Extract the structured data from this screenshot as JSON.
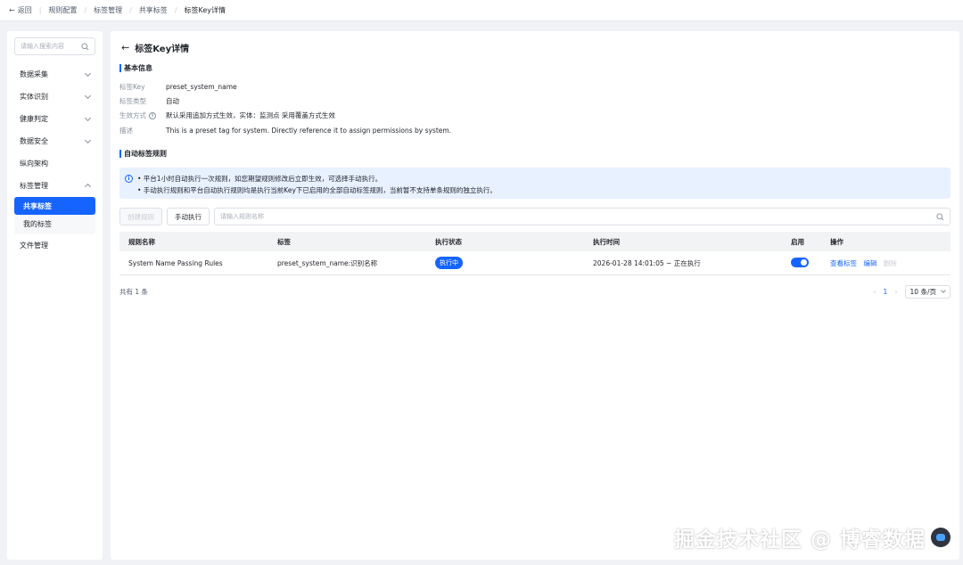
{
  "breadcrumb": {
    "back": "返回",
    "items": [
      "规则配置",
      "标签管理",
      "共享标签",
      "标签Key详情"
    ]
  },
  "sidebar": {
    "search_placeholder": "请输入搜索内容",
    "items": [
      {
        "label": "数据采集"
      },
      {
        "label": "实体识别"
      },
      {
        "label": "健康判定"
      },
      {
        "label": "数据安全"
      },
      {
        "label": "纵向架构"
      },
      {
        "label": "标签管理"
      },
      {
        "label": "文件管理"
      }
    ],
    "sub_items": [
      {
        "label": "共享标签"
      },
      {
        "label": "我的标签"
      }
    ]
  },
  "page": {
    "title": "标签Key详情",
    "basic_section": "基本信息",
    "fields": {
      "key_label": "标签Key",
      "key_value": "preset_system_name",
      "type_label": "标签类型",
      "type_value": "自动",
      "effect_label": "生效方式",
      "effect_value": "默认采用追加方式生效，实体：监测点 采用覆盖方式生效",
      "desc_label": "描述",
      "desc_value": "This is a preset tag for system. Directly reference it to assign permissions by system."
    },
    "rules_section": "自动标签规则",
    "notice": [
      "• 平台1小时自动执行一次规则，如您期望规则修改后立即生效，可选择手动执行。",
      "• 手动执行规则和平台自动执行规则均是执行当前Key下已启用的全部自动标签规则，当前暂不支持单条规则的独立执行。"
    ],
    "toolbar": {
      "create": "创建规则",
      "manual": "手动执行",
      "search_placeholder": "请输入规则名称"
    },
    "table": {
      "headers": [
        "规则名称",
        "标签",
        "执行状态",
        "执行时间",
        "启用",
        "操作"
      ],
      "rows": [
        {
          "name": "System Name Passing Rules",
          "tag": "preset_system_name:识别名称",
          "status": "执行中",
          "time": "2026-01-28 14:01:05 ~ 正在执行",
          "enabled": true,
          "ops": [
            "查看标签",
            "编辑",
            "删除"
          ]
        }
      ]
    },
    "footer": {
      "total": "共有 1 条",
      "current_page": "1",
      "page_size": "10 条/页"
    }
  },
  "watermark": "掘金技术社区 @ 博睿数据",
  "colors": {
    "accent": "#1664ff",
    "notice_bg": "#e8f1ff"
  }
}
